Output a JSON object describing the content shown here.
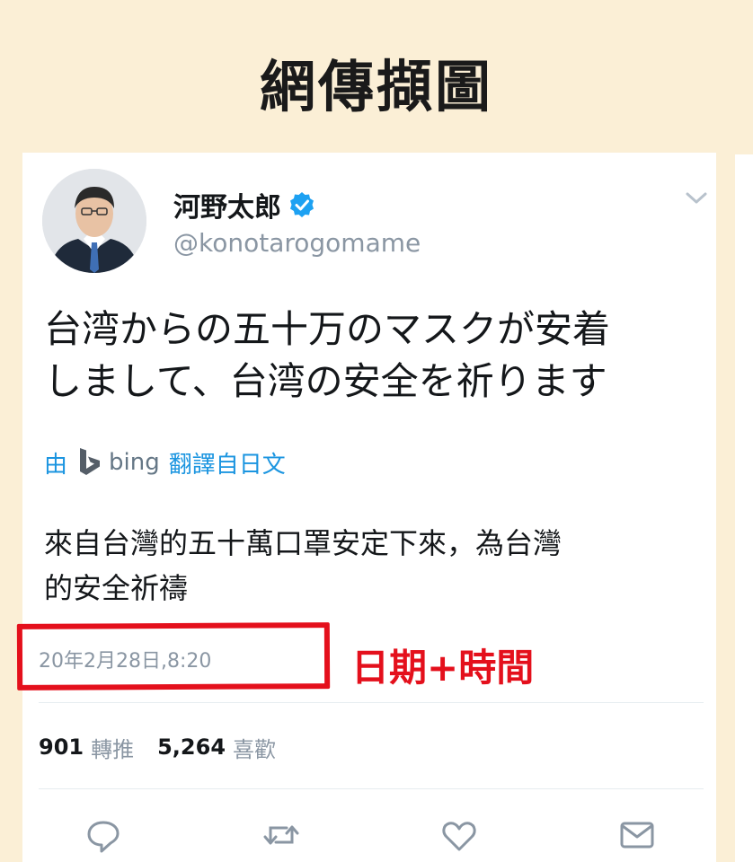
{
  "page_heading": "網傳擷圖",
  "tweet": {
    "display_name": "河野太郎",
    "handle": "@konotarogomame",
    "text_line1": "台湾からの五十万のマスクが安着",
    "text_line2": "しまして、台湾の安全を祈ります",
    "translate": {
      "prefix": "由",
      "engine": "bing",
      "suffix": "翻譯自日文"
    },
    "translated_line1": "來自台灣的五十萬口罩安定下來，為台灣",
    "translated_line2": "的安全祈禱",
    "timestamp": "20年2月28日,8:20",
    "retweet_count": "901",
    "retweet_label": "轉推",
    "like_count": "5,264",
    "like_label": "喜歡"
  },
  "annotation": {
    "label": "日期+時間",
    "color": "#e4101c"
  },
  "icons": {
    "verified": "verified-badge-icon",
    "menu": "chevron-down-icon",
    "translate_engine": "bing-logo-icon",
    "reply": "reply-icon",
    "retweet": "retweet-icon",
    "like": "heart-icon",
    "message": "envelope-icon"
  },
  "colors": {
    "background": "#fbefd6",
    "link_blue": "#1b95e0",
    "muted_text": "#8a96a3",
    "verified_blue": "#1da1f2"
  }
}
